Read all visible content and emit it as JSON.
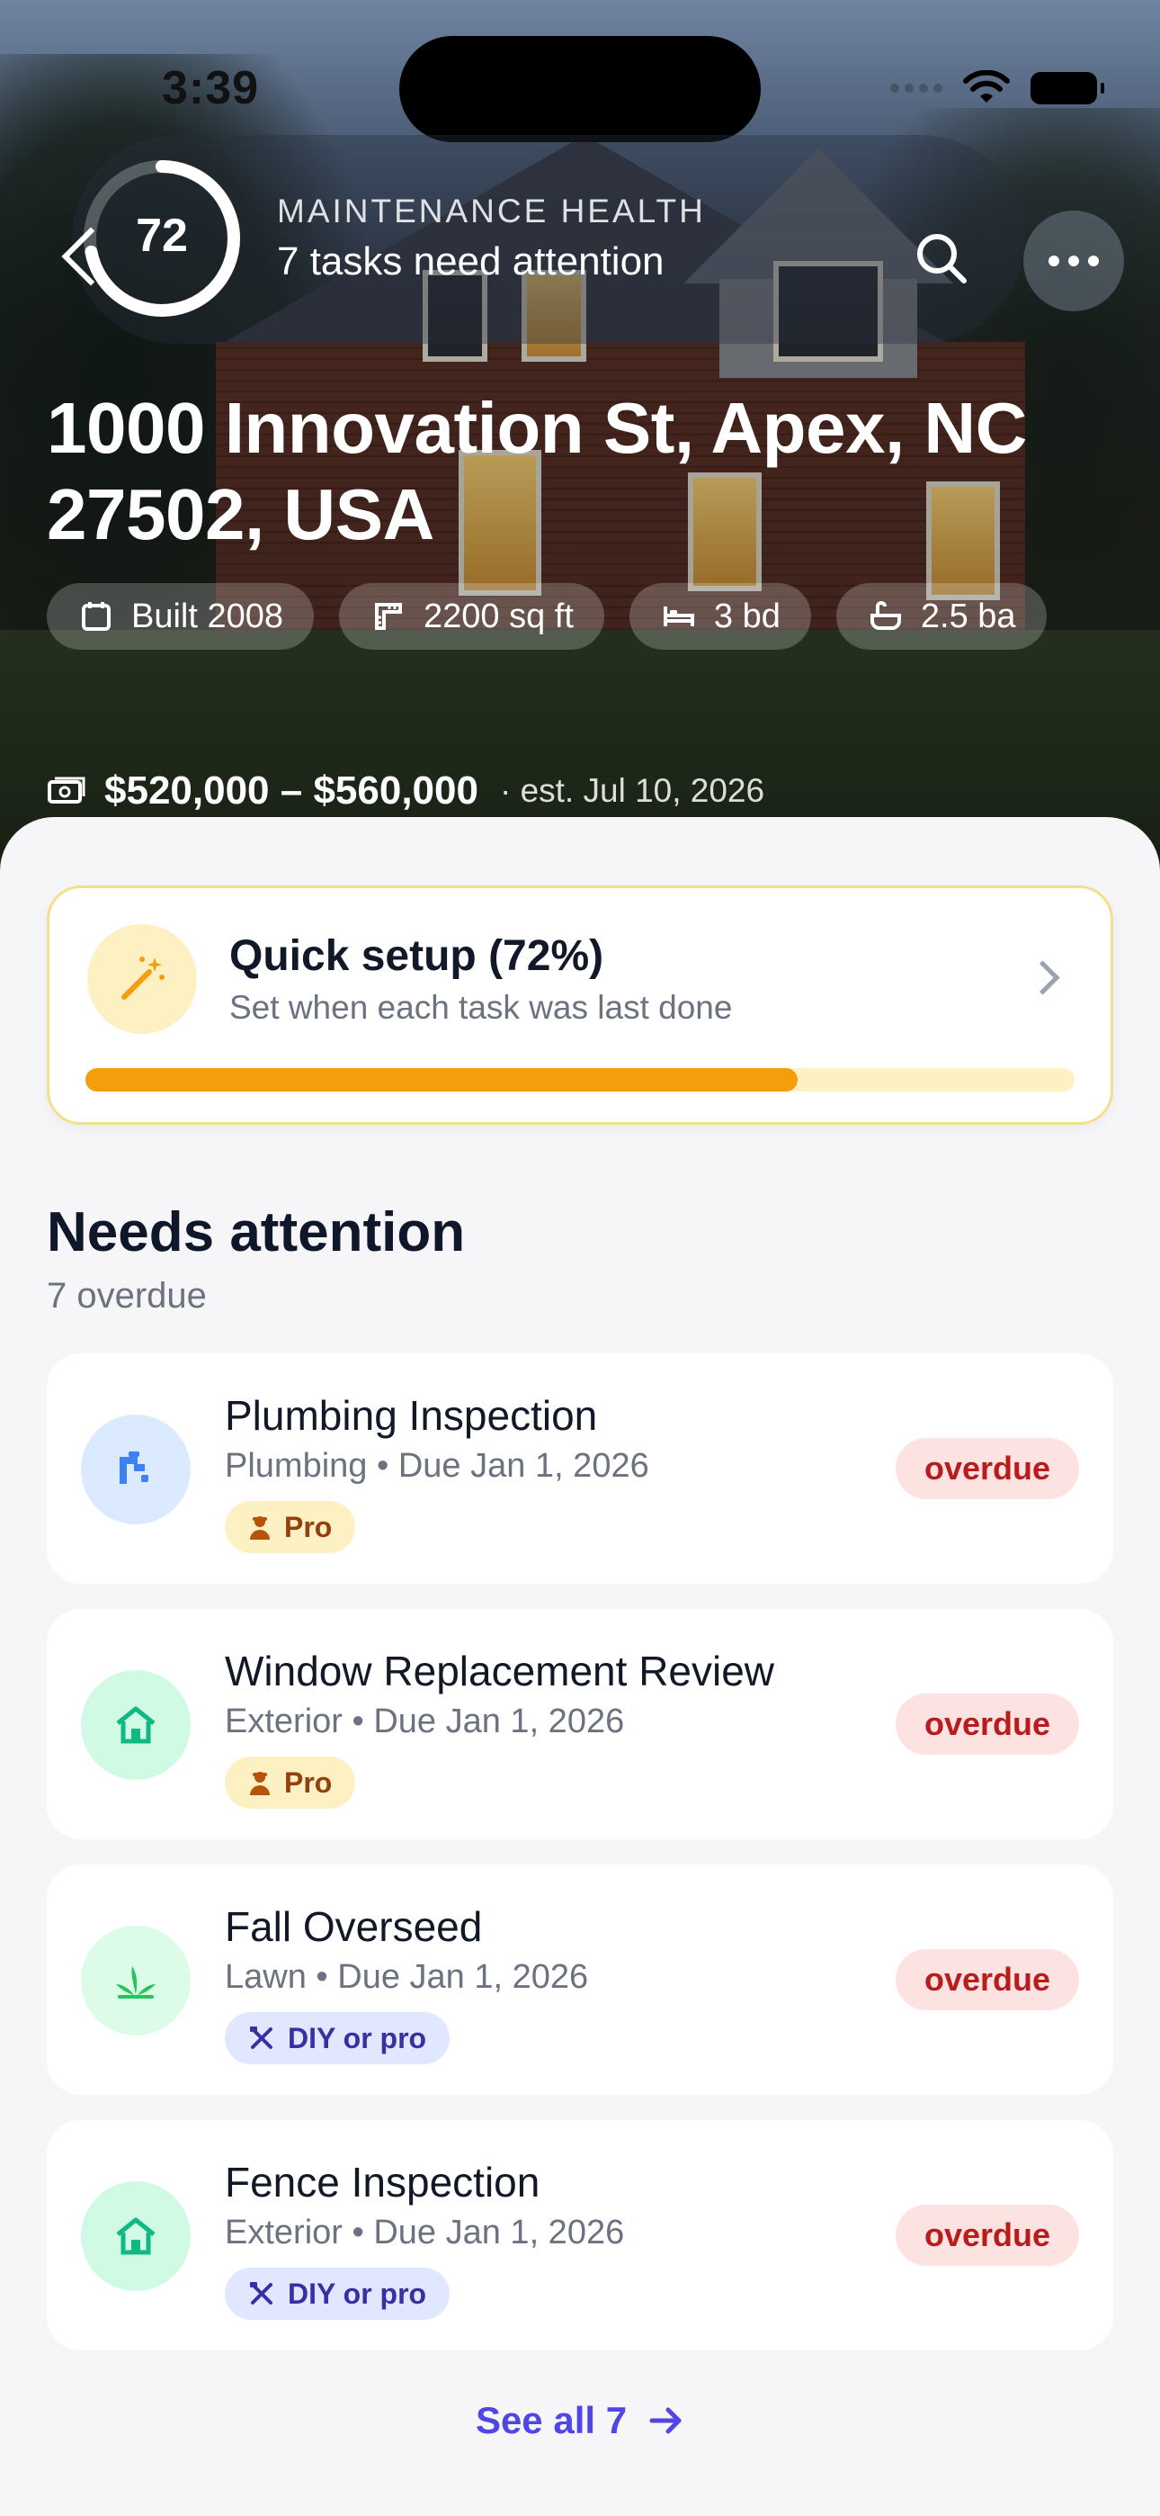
{
  "status_bar": {
    "time": "3:39"
  },
  "header": {
    "health_score": "72",
    "health_fraction": 0.72,
    "health_label": "MAINTENANCE HEALTH",
    "health_sub": "7 tasks need attention"
  },
  "property": {
    "address": "1000 Innovation St, Apex, NC 27502, USA",
    "chips": [
      {
        "icon": "calendar-icon",
        "label": "Built 2008"
      },
      {
        "icon": "ruler-icon",
        "label": "2200 sq ft"
      },
      {
        "icon": "bed-icon",
        "label": "3 bd"
      },
      {
        "icon": "bathtub-icon",
        "label": "2.5 ba"
      }
    ],
    "price_range": "$520,000 – $560,000",
    "price_estimate": "· est. Jul 10, 2026"
  },
  "setup": {
    "title": "Quick setup (72%)",
    "subtitle": "Set when each task was last done",
    "progress": 0.72,
    "accent": "#f59e0b"
  },
  "needs_attention": {
    "title": "Needs attention",
    "subtitle": "7 overdue",
    "tasks": [
      {
        "title": "Plumbing Inspection",
        "meta": "Plumbing • Due Jan 1, 2026",
        "tag": "Pro",
        "tag_type": "pro",
        "status": "overdue",
        "icon": "plumbing-icon",
        "icon_bg": "#dbeafe",
        "icon_color": "#3b82f6"
      },
      {
        "title": "Window Replacement Review",
        "meta": "Exterior • Due Jan 1, 2026",
        "tag": "Pro",
        "tag_type": "pro",
        "status": "overdue",
        "icon": "house-icon",
        "icon_bg": "#d1fae5",
        "icon_color": "#10b981"
      },
      {
        "title": "Fall Overseed",
        "meta": "Lawn • Due Jan 1, 2026",
        "tag": "DIY or pro",
        "tag_type": "diy",
        "status": "overdue",
        "icon": "grass-icon",
        "icon_bg": "#dcfce7",
        "icon_color": "#22c55e"
      },
      {
        "title": "Fence Inspection",
        "meta": "Exterior • Due Jan 1, 2026",
        "tag": "DIY or pro",
        "tag_type": "diy",
        "status": "overdue",
        "icon": "house-icon",
        "icon_bg": "#d1fae5",
        "icon_color": "#10b981"
      }
    ],
    "see_all": "See all 7"
  }
}
